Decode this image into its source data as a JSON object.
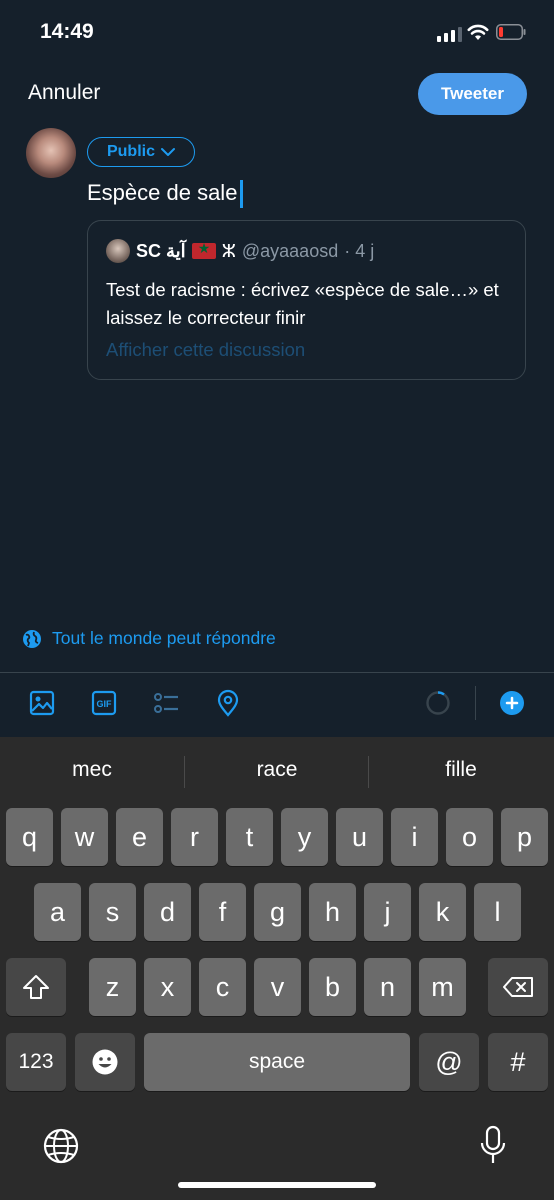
{
  "status_bar": {
    "time": "14:49"
  },
  "header": {
    "cancel_label": "Annuler",
    "tweet_label": "Tweeter"
  },
  "composer": {
    "audience_label": "Public",
    "text": "Espèce de sale"
  },
  "quoted_tweet": {
    "name": "SC آية",
    "tifinagh": "ⵣ",
    "handle": "@ayaaaosd",
    "time": "· 4 j",
    "body": "Test de racisme : écrivez «espèce de sale…» et laissez le correcteur finir",
    "show_thread": "Afficher cette discussion"
  },
  "reply_setting": {
    "label": "Tout le monde peut répondre"
  },
  "toolbar": {
    "icons": [
      "image-icon",
      "gif-icon",
      "poll-icon",
      "location-icon",
      "char-count-ring-icon",
      "add-thread-icon"
    ],
    "gif_label": "GIF"
  },
  "keyboard": {
    "suggestions": [
      "mec",
      "race",
      "fille"
    ],
    "row1": [
      "q",
      "w",
      "e",
      "r",
      "t",
      "y",
      "u",
      "i",
      "o",
      "p"
    ],
    "row2": [
      "a",
      "s",
      "d",
      "f",
      "g",
      "h",
      "j",
      "k",
      "l"
    ],
    "row3": [
      "z",
      "x",
      "c",
      "v",
      "b",
      "n",
      "m"
    ],
    "numbers_label": "123",
    "space_label": "space",
    "at_label": "@",
    "hash_label": "#"
  },
  "colors": {
    "background": "#15202b",
    "accent": "#1d9bf0",
    "button": "#4a99e9",
    "keyboard": "#2b2b2b"
  }
}
